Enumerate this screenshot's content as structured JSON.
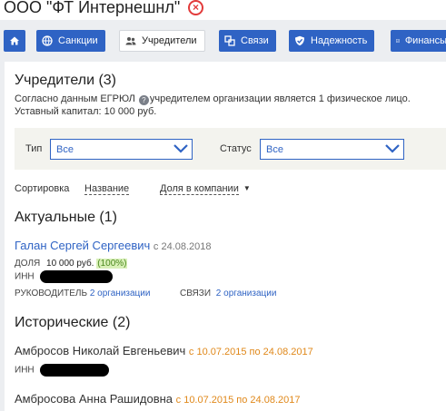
{
  "header": {
    "company_name": "ООО \"ФТ Интернешнл\""
  },
  "nav": {
    "home_icon": "home-icon",
    "items": [
      {
        "label": "Санкции",
        "icon": "globe-icon"
      },
      {
        "label": "Учредители",
        "icon": "people-icon",
        "active": true
      },
      {
        "label": "Связи",
        "icon": "links-icon"
      },
      {
        "label": "Надежность",
        "icon": "shield-icon"
      },
      {
        "label": "Финансы",
        "icon": "chart-icon"
      }
    ]
  },
  "founders": {
    "title": "Учредители (3)",
    "desc_part1": "Согласно данным ЕГРЮЛ",
    "desc_part2": "учредителем организации является 1 физическое лицо.",
    "capital": "Уставный капитал: 10 000 руб.",
    "filter": {
      "type_label": "Тип",
      "type_value": "Все",
      "status_label": "Статус",
      "status_value": "Все"
    },
    "sort": {
      "label": "Сортировка",
      "by_name": "Название",
      "by_share": "Доля в компании"
    },
    "current": {
      "title": "Актуальные (1)",
      "person_name": "Галан Сергей Сергеевич",
      "since": "с 24.08.2018",
      "share_label": "ДОЛЯ",
      "share_value": "10 000 руб.",
      "share_pct": "(100%)",
      "inn_label": "ИНН",
      "director_label": "РУКОВОДИТЕЛЬ",
      "director_value": "2 организации",
      "links_label": "СВЯЗИ",
      "links_value": "2 организации"
    },
    "historical": {
      "title": "Исторические (2)",
      "people": [
        {
          "name": "Амбросов Николай Евгеньевич",
          "period": "с 10.07.2015 по 24.08.2017",
          "inn_label": "ИНН"
        },
        {
          "name": "Амбросова Анна Рашидовна",
          "period": "с 10.07.2015 по 24.08.2017"
        }
      ]
    }
  },
  "colors": {
    "accent": "#2f63c4",
    "date": "#e0881a",
    "close": "#e23b3b"
  }
}
